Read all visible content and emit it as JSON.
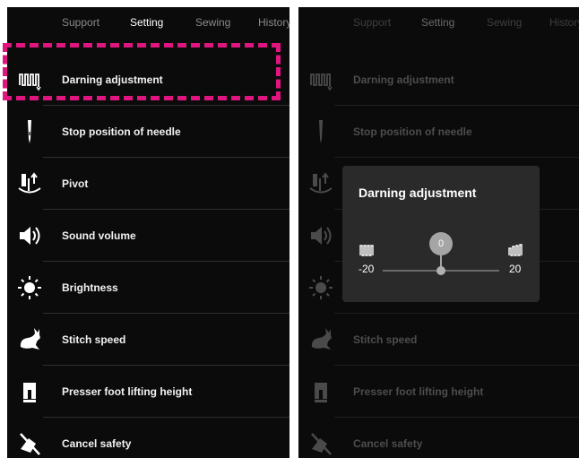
{
  "tabs": [
    "Support",
    "Setting",
    "Sewing",
    "History"
  ],
  "active_tab": "Setting",
  "settings_items": [
    {
      "label": "Darning adjustment",
      "icon": "darning-icon"
    },
    {
      "label": "Stop position of needle",
      "icon": "needle-icon"
    },
    {
      "label": "Pivot",
      "icon": "pivot-icon"
    },
    {
      "label": "Sound volume",
      "icon": "speaker-icon"
    },
    {
      "label": "Brightness",
      "icon": "sun-icon"
    },
    {
      "label": "Stitch speed",
      "icon": "rabbit-icon"
    },
    {
      "label": "Presser foot lifting height",
      "icon": "presser-foot-icon"
    },
    {
      "label": "Cancel safety",
      "icon": "cancel-safety-icon"
    }
  ],
  "colors": {
    "highlight": "#e0157f",
    "background": "#0b0b0b",
    "dialog": "#2a2a2a"
  },
  "dialog": {
    "title": "Darning adjustment",
    "min_label": "-20",
    "max_label": "20",
    "min": -20,
    "max": 20,
    "value": 0,
    "value_label": "0"
  }
}
